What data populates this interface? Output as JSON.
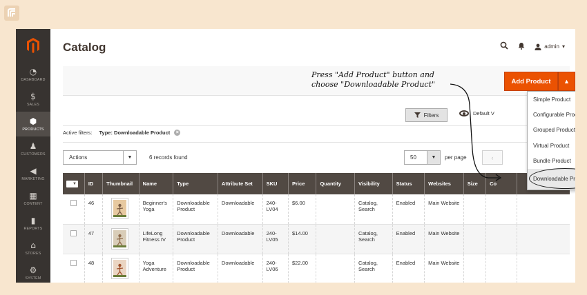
{
  "sidebar": {
    "items": [
      {
        "label": "DASHBOARD",
        "icon": "dashboard-icon",
        "glyph": "◔"
      },
      {
        "label": "SALES",
        "icon": "dollar-icon",
        "glyph": "$"
      },
      {
        "label": "PRODUCTS",
        "icon": "cube-icon",
        "glyph": "⬢"
      },
      {
        "label": "CUSTOMERS",
        "icon": "person-icon",
        "glyph": "♟"
      },
      {
        "label": "MARKETING",
        "icon": "megaphone-icon",
        "glyph": "◀"
      },
      {
        "label": "CONTENT",
        "icon": "layout-icon",
        "glyph": "▦"
      },
      {
        "label": "REPORTS",
        "icon": "bar-chart-icon",
        "glyph": "▮"
      },
      {
        "label": "STORES",
        "icon": "store-icon",
        "glyph": "⌂"
      },
      {
        "label": "SYSTEM",
        "icon": "gear-icon",
        "glyph": "⚙"
      }
    ],
    "active_index": 2
  },
  "header": {
    "title": "Catalog",
    "user": "admin",
    "user_caret": "▾"
  },
  "annotation": {
    "line1": "Press \"Add Product\" button and",
    "line2": "choose \"Downloadable Product\""
  },
  "add_product": {
    "label": "Add Product",
    "toggle_glyph": "▲",
    "options": [
      "Simple Product",
      "Configurable Product",
      "Grouped Product",
      "Virtual Product",
      "Bundle Product",
      "Downloadable Product"
    ],
    "highlighted_option": "Downloadable Product"
  },
  "toolbar": {
    "filters_label": "Filters",
    "view_label": "Default V",
    "active_filters_label": "Active filters:",
    "active_filter": "Type: Downloadable Product",
    "remove_glyph": "×",
    "actions_label": "Actions",
    "records_found": "6 records found",
    "per_page_value": "50",
    "per_page_label": "per page",
    "prev_glyph": "‹",
    "select_arrow": "▼"
  },
  "grid": {
    "columns": [
      "ID",
      "Thumbnail",
      "Name",
      "Type",
      "Attribute Set",
      "SKU",
      "Price",
      "Quantity",
      "Visibility",
      "Status",
      "Websites",
      "Size",
      "Co",
      ""
    ],
    "rows": [
      {
        "id": "46",
        "name": "Beginner's Yoga",
        "type": "Downloadable Product",
        "attribute_set": "Downloadable",
        "sku": "240-LV04",
        "price": "$6.00",
        "quantity": "",
        "visibility": "Catalog, Search",
        "status": "Enabled",
        "websites": "Main Website",
        "size": ""
      },
      {
        "id": "47",
        "name": "LifeLong Fitness IV",
        "type": "Downloadable Product",
        "attribute_set": "Downloadable",
        "sku": "240-LV05",
        "price": "$14.00",
        "quantity": "",
        "visibility": "Catalog, Search",
        "status": "Enabled",
        "websites": "Main Website",
        "size": ""
      },
      {
        "id": "48",
        "name": "Yoga Adventure",
        "type": "Downloadable Product",
        "attribute_set": "Downloadable",
        "sku": "240-LV06",
        "price": "$22.00",
        "quantity": "",
        "visibility": "Catalog, Search",
        "status": "Enabled",
        "websites": "Main Website",
        "size": ""
      }
    ]
  },
  "colors": {
    "accent": "#eb5202",
    "sidebar_bg": "#373330",
    "grid_header": "#514943",
    "page_bg": "#f8e6cf"
  }
}
